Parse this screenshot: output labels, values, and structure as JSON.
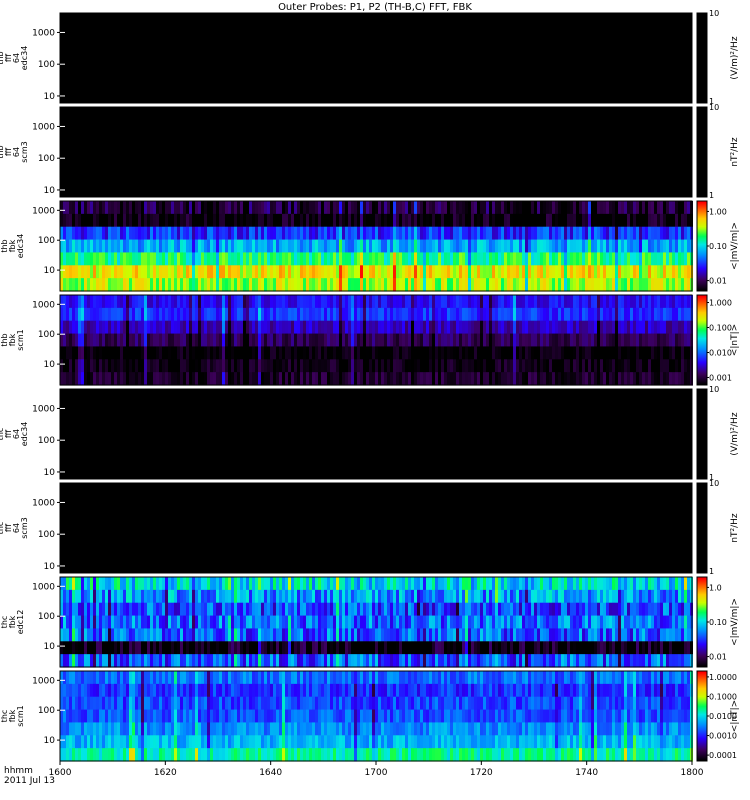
{
  "chart_data": {
    "type": "heatmap",
    "title": "Outer Probes: P1, P2 (TH-B,C) FFT, FBK",
    "time_axis": {
      "label_line1": "hhmm",
      "label_line2": "2011 Jul 13",
      "ticks": [
        "1600",
        "1620",
        "1640",
        "1700",
        "1720",
        "1740",
        "1800"
      ],
      "range_minutes": [
        0,
        120
      ]
    },
    "panels": [
      {
        "id": "thb-fft-edc34",
        "ylabel": [
          "thb",
          "fff",
          "64",
          "edc34"
        ],
        "kind": "fft",
        "yticks": [
          "1000",
          "100",
          "10"
        ],
        "ytick_values": [
          1000,
          100,
          10
        ],
        "ylim": [
          6,
          4096
        ],
        "colorbar": {
          "label": "(V/m)²/Hz",
          "ticks": [
            "10",
            "1"
          ],
          "scale": "gray"
        },
        "fill": "#000000"
      },
      {
        "id": "thb-fft-scm3",
        "ylabel": [
          "thb",
          "fff",
          "64",
          "scm3"
        ],
        "kind": "fft",
        "yticks": [
          "1000",
          "100",
          "10"
        ],
        "ytick_values": [
          1000,
          100,
          10
        ],
        "ylim": [
          6,
          4096
        ],
        "colorbar": {
          "label": "nT²/Hz",
          "ticks": [
            "10",
            "1"
          ],
          "scale": "gray"
        },
        "fill": "#000000"
      },
      {
        "id": "thb-fbk-edc34",
        "ylabel": [
          "thb",
          "fbk",
          "edc34"
        ],
        "kind": "fbk",
        "yticks": [
          "1000",
          "100",
          "10"
        ],
        "ytick_values": [
          1000,
          100,
          10
        ],
        "ylim": [
          2,
          2048
        ],
        "colorbar": {
          "label": "<|mV/m|>",
          "ticks": [
            "1.00",
            "0.10",
            "0.01"
          ],
          "tick_values": [
            1,
            0.1,
            0.01
          ],
          "log_range": [
            0.005,
            2
          ],
          "scale": "rainbow"
        },
        "band_levels": [
          0.008,
          0.005,
          0.03,
          0.07,
          0.18,
          0.5,
          0.35
        ],
        "band_color_hint": [
          "#ff3000",
          "#ff8000",
          "#a0ff00",
          "#00a0ff",
          "#30108a",
          "#000000",
          "#2040ff"
        ],
        "variability": 0.4
      },
      {
        "id": "thb-fbk-scm1",
        "ylabel": [
          "thb",
          "fbk",
          "scm1"
        ],
        "kind": "fbk",
        "yticks": [
          "1000",
          "100",
          "10"
        ],
        "ytick_values": [
          1000,
          100,
          10
        ],
        "ylim": [
          2,
          2048
        ],
        "colorbar": {
          "label": "<|nT|>",
          "ticks": [
            "1.000",
            "0.100",
            "0.010",
            "0.001"
          ],
          "tick_values": [
            1,
            0.1,
            0.01,
            0.001
          ],
          "log_range": [
            0.0005,
            2
          ],
          "scale": "rainbow"
        },
        "band_levels": [
          0.004,
          0.006,
          0.0025,
          0.0012,
          0.0005,
          0.0006,
          0.0008
        ],
        "variability": 0.25
      },
      {
        "id": "thc-fft-edc34",
        "ylabel": [
          "thc",
          "fff",
          "64",
          "edc34"
        ],
        "kind": "fft",
        "yticks": [
          "1000",
          "100",
          "10"
        ],
        "ytick_values": [
          1000,
          100,
          10
        ],
        "ylim": [
          6,
          4096
        ],
        "colorbar": {
          "label": "(V/m)²/Hz",
          "ticks": [
            "10",
            "1"
          ],
          "scale": "gray"
        },
        "fill": "#000000"
      },
      {
        "id": "thc-fft-scm3",
        "ylabel": [
          "thc",
          "fff",
          "64",
          "scm3"
        ],
        "kind": "fft",
        "yticks": [
          "1000",
          "100",
          "10"
        ],
        "ytick_values": [
          1000,
          100,
          10
        ],
        "ylim": [
          6,
          4096
        ],
        "colorbar": {
          "label": "nT²/Hz",
          "ticks": [
            "10",
            "1"
          ],
          "scale": "gray"
        },
        "fill": "#000000"
      },
      {
        "id": "thc-fbk-edc12",
        "ylabel": [
          "thc",
          "fbk",
          "edc12"
        ],
        "kind": "fbk",
        "yticks": [
          "1000",
          "100",
          "10"
        ],
        "ytick_values": [
          1000,
          100,
          10
        ],
        "ylim": [
          2,
          2048
        ],
        "colorbar": {
          "label": "<|mV/m|>",
          "ticks": [
            "1.0",
            "0.10",
            "0.01"
          ],
          "tick_values": [
            1,
            0.1,
            0.01
          ],
          "log_range": [
            0.005,
            2
          ],
          "scale": "rainbow"
        },
        "band_levels": [
          0.1,
          0.06,
          0.035,
          0.045,
          0.04,
          0.005,
          0.04
        ],
        "variability": 0.55
      },
      {
        "id": "thc-fbk-scm1",
        "ylabel": [
          "thc",
          "fbk",
          "scm1"
        ],
        "kind": "fbk",
        "yticks": [
          "1000",
          "100",
          "10"
        ],
        "ytick_values": [
          1000,
          100,
          10
        ],
        "ylim": [
          2,
          2048
        ],
        "colorbar": {
          "label": "<|nT|>",
          "ticks": [
            "1.0000",
            "0.1000",
            "0.0100",
            "0.0010",
            "0.0001"
          ],
          "tick_values": [
            1,
            0.1,
            0.01,
            0.001,
            0.0001
          ],
          "log_range": [
            5e-05,
            2
          ],
          "scale": "rainbow"
        },
        "band_levels": [
          0.0025,
          0.0012,
          0.0015,
          0.0018,
          0.0035,
          0.006,
          0.02
        ],
        "variability": 0.3
      }
    ]
  }
}
